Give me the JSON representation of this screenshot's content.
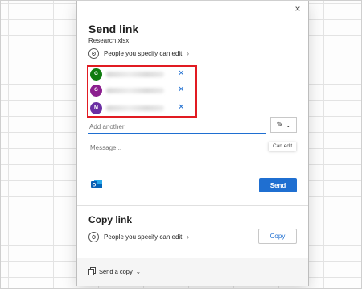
{
  "dialog": {
    "title": "Send link",
    "filename": "Research.xlsx",
    "permission": "People you specify can edit",
    "permission_chevron": "›",
    "close_glyph": "×"
  },
  "recipients": [
    {
      "initial": "G",
      "color": "#107c10"
    },
    {
      "initial": "G",
      "color": "#8c1f8f"
    },
    {
      "initial": "M",
      "color": "#6b2fa3"
    }
  ],
  "remove_glyph": "✕",
  "add_placeholder": "Add another",
  "edit_dropdown": {
    "pencil_glyph": "✎",
    "chevron_glyph": "⌄",
    "tooltip": "Can edit"
  },
  "message_placeholder": "Message...",
  "send_label": "Send",
  "copy_link": {
    "title": "Copy link",
    "permission": "People you specify can edit",
    "chevron": "›",
    "copy_label": "Copy"
  },
  "footer": {
    "send_copy_label": "Send a copy",
    "chevron": "⌄"
  },
  "colors": {
    "accent": "#1f6fd1",
    "highlight": "#e11b22"
  }
}
